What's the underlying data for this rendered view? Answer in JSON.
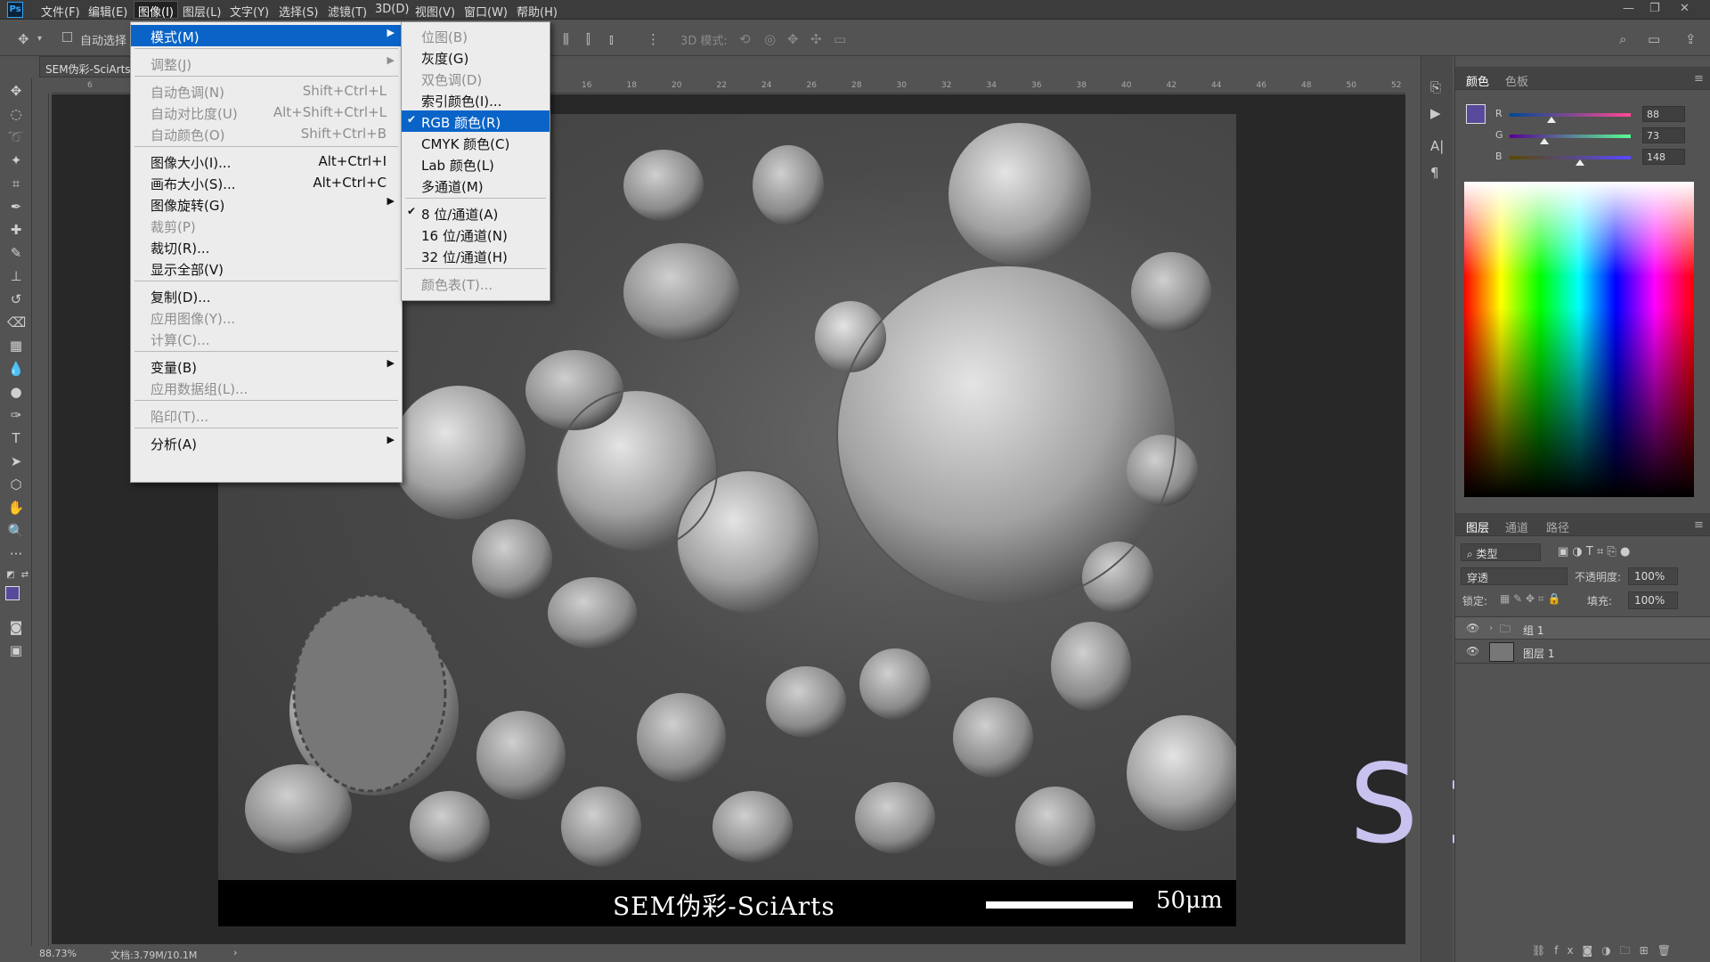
{
  "menubar": {
    "items": [
      "文件(F)",
      "编辑(E)",
      "图像(I)",
      "图层(L)",
      "文字(Y)",
      "选择(S)",
      "滤镜(T)",
      "3D(D)",
      "视图(V)",
      "窗口(W)",
      "帮助(H)"
    ],
    "active": "图像(I)"
  },
  "options": {
    "auto_select": "自动选择",
    "mode_3d": "3D 模式:"
  },
  "document": {
    "tab_title": "SEM伪彩-SciArts",
    "zoom": "88.73%",
    "doc_size": "文档:3.79M/10.1M"
  },
  "image": {
    "caption": "SEM伪彩-SciArts",
    "scale_label": "50μm"
  },
  "watermark": "SciArts",
  "image_menu": [
    {
      "label": "模式(M)",
      "submenu": true,
      "highlighted": true
    },
    {
      "sep": true
    },
    {
      "label": "调整(J)",
      "submenu": true,
      "disabled": true
    },
    {
      "sep": true
    },
    {
      "label": "自动色调(N)",
      "shortcut": "Shift+Ctrl+L",
      "disabled": true
    },
    {
      "label": "自动对比度(U)",
      "shortcut": "Alt+Shift+Ctrl+L",
      "disabled": true
    },
    {
      "label": "自动颜色(O)",
      "shortcut": "Shift+Ctrl+B",
      "disabled": true
    },
    {
      "sep": true
    },
    {
      "label": "图像大小(I)...",
      "shortcut": "Alt+Ctrl+I"
    },
    {
      "label": "画布大小(S)...",
      "shortcut": "Alt+Ctrl+C"
    },
    {
      "label": "图像旋转(G)",
      "submenu": true
    },
    {
      "label": "裁剪(P)",
      "disabled": true
    },
    {
      "label": "裁切(R)..."
    },
    {
      "label": "显示全部(V)"
    },
    {
      "sep": true
    },
    {
      "label": "复制(D)..."
    },
    {
      "label": "应用图像(Y)...",
      "disabled": true
    },
    {
      "label": "计算(C)...",
      "disabled": true
    },
    {
      "sep": true
    },
    {
      "label": "变量(B)",
      "submenu": true
    },
    {
      "label": "应用数据组(L)...",
      "disabled": true
    },
    {
      "sep": true
    },
    {
      "label": "陷印(T)...",
      "disabled": true
    },
    {
      "sep": true
    },
    {
      "label": "分析(A)",
      "submenu": true
    }
  ],
  "mode_menu": [
    {
      "label": "位图(B)",
      "disabled": true
    },
    {
      "label": "灰度(G)"
    },
    {
      "label": "双色调(D)",
      "disabled": true
    },
    {
      "label": "索引颜色(I)..."
    },
    {
      "label": "RGB 颜色(R)",
      "checked": true,
      "highlighted": true
    },
    {
      "label": "CMYK 颜色(C)"
    },
    {
      "label": "Lab 颜色(L)"
    },
    {
      "label": "多通道(M)"
    },
    {
      "sep": true
    },
    {
      "label": "8 位/通道(A)",
      "checked": true
    },
    {
      "label": "16 位/通道(N)"
    },
    {
      "label": "32 位/通道(H)"
    },
    {
      "sep": true
    },
    {
      "label": "颜色表(T)...",
      "disabled": true
    }
  ],
  "color_panel": {
    "tabs": [
      "颜色",
      "色板"
    ],
    "r_label": "R",
    "g_label": "G",
    "b_label": "B",
    "r": "88",
    "g": "73",
    "b": "148",
    "r_frac": 0.345,
    "g_frac": 0.286,
    "b_frac": 0.58,
    "fg_color": "#58499a"
  },
  "layers_panel": {
    "tabs": [
      "图层",
      "通道",
      "路径"
    ],
    "filter": "类型",
    "blend_mode": "穿透",
    "opacity_label": "不透明度:",
    "opacity": "100%",
    "lock_label": "锁定:",
    "fill_label": "填充:",
    "fill": "100%",
    "layers": [
      "组 1",
      "图层 1"
    ]
  },
  "ruler": {
    "h_ticks": [
      "16",
      "18",
      "20",
      "22",
      "24",
      "26",
      "28",
      "30",
      "32",
      "34",
      "36",
      "38",
      "40",
      "42",
      "44",
      "46",
      "48",
      "50",
      "52"
    ],
    "h_left": "6"
  }
}
